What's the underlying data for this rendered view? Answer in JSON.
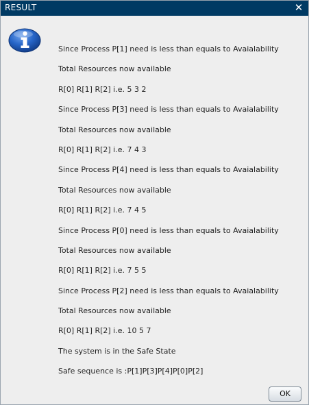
{
  "window": {
    "title": "RESULT",
    "close_glyph": "✕",
    "icon": "information-icon"
  },
  "message": {
    "lines": [
      "Since Process P[1] need is less than equals to Avaialability",
      "Total Resources now available",
      "R[0] R[1] R[2] i.e. 5 3 2",
      "Since Process P[3] need is less than equals to Avaialability",
      "Total Resources now available",
      "R[0] R[1] R[2] i.e. 7 4 3",
      "Since Process P[4] need is less than equals to Avaialability",
      "Total Resources now available",
      "R[0] R[1] R[2] i.e. 7 4 5",
      "Since Process P[0] need is less than equals to Avaialability",
      "Total Resources now available",
      "R[0] R[1] R[2] i.e. 7 5 5",
      "Since Process P[2] need is less than equals to Avaialability",
      "Total Resources now available",
      "R[0] R[1] R[2] i.e. 10 5 7",
      "The system is in the Safe State",
      "Safe sequence is :P[1]P[3]P[4]P[0]P[2]"
    ]
  },
  "buttons": {
    "ok_label": "OK"
  },
  "colors": {
    "titlebar": "#003a63",
    "dialog_background": "#eeeeee",
    "icon_blue": "#1e5fbf"
  }
}
